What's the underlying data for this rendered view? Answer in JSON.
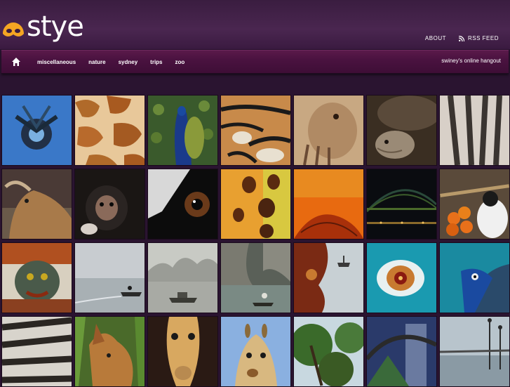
{
  "header": {
    "logo_text": "stye",
    "links": [
      {
        "label": "ABOUT",
        "icon": ""
      },
      {
        "label": "RSS FEED",
        "icon": "rss-icon"
      }
    ]
  },
  "nav": {
    "home_icon": "home-icon",
    "items": [
      "miscellaneous",
      "nature",
      "sydney",
      "trips",
      "zoo"
    ],
    "tagline": "swiney's online hangout"
  },
  "colors": {
    "background": "#2a1430",
    "nav_bar": "#4a1240",
    "logo_orange": "#f5a623"
  },
  "gallery": {
    "thumbnails": [
      {
        "subject": "blue ornament sculpture"
      },
      {
        "subject": "giraffe skin"
      },
      {
        "subject": "peacock"
      },
      {
        "subject": "tiger"
      },
      {
        "subject": "meerkat"
      },
      {
        "subject": "tortoise"
      },
      {
        "subject": "zebra"
      },
      {
        "subject": "mountain goat"
      },
      {
        "subject": "monkey"
      },
      {
        "subject": "lemur eye"
      },
      {
        "subject": "giraffe spots"
      },
      {
        "subject": "orange leaf"
      },
      {
        "subject": "harbour bridge at night"
      },
      {
        "subject": "oranges vendor"
      },
      {
        "subject": "dragon statue"
      },
      {
        "subject": "boat on water"
      },
      {
        "subject": "misty bay boat"
      },
      {
        "subject": "halong bay rowboat"
      },
      {
        "subject": "carved wood and boat"
      },
      {
        "subject": "peacock eye feather"
      },
      {
        "subject": "peacock head"
      },
      {
        "subject": "zebra stripes"
      },
      {
        "subject": "jackal"
      },
      {
        "subject": "giraffe face"
      },
      {
        "subject": "giraffe head"
      },
      {
        "subject": "tree and city"
      },
      {
        "subject": "arched building"
      },
      {
        "subject": "riverside lamp posts"
      }
    ]
  }
}
